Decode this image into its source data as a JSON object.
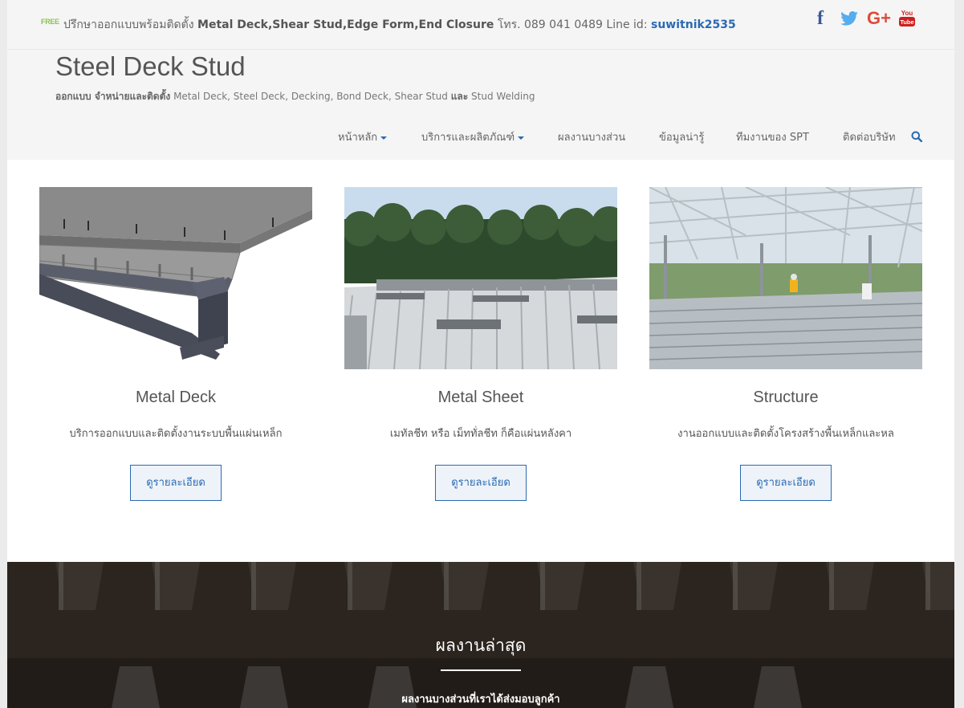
{
  "topbar": {
    "free_badge": "FREE",
    "text_prefix": "ปรึกษาออกแบบพร้อมติดตั้ง ",
    "text_products": "Metal Deck,Shear Stud,Edge Form,End Closure",
    "text_phone": " โทร. 089 041 0489 Line id: ",
    "line_id": "suwitnik2535",
    "social": {
      "facebook": "f",
      "google_plus": "G+",
      "youtube_top": "You",
      "youtube_bottom": "Tube"
    }
  },
  "header": {
    "site_title": "Steel Deck Stud",
    "tagline_lead": "ออกแบบ จำหน่ายและติดตั้ง",
    "tagline_items": " Metal Deck, Steel Deck, Decking, Bond Deck, Shear Stud ",
    "tagline_and": "และ",
    "tagline_tail": " Stud Welding"
  },
  "nav": {
    "home": "หน้าหลัก",
    "services": "บริการและผลิตภัณฑ์",
    "portfolio": "ผลงานบางส่วน",
    "info": "ข้อมูลน่ารู้",
    "team": "ทีมงานของ SPT",
    "contact": "ติดต่อบริษัท"
  },
  "services": [
    {
      "title": "Metal Deck",
      "desc": "บริการออกแบบและติดตั้งงานระบบพื้นแผ่นเหล็ก",
      "button": "ดูรายละเอียด"
    },
    {
      "title": "Metal Sheet",
      "desc": "เมทัลชีท หรือ เม็ททั่ลชีท ก็คือแผ่นหลังคา",
      "button": "ดูรายละเอียด"
    },
    {
      "title": "Structure",
      "desc": "งานออกแบบและติดตั้งโครงสร้างพื้นเหล็กและหล",
      "button": "ดูรายละเอียด"
    }
  ],
  "latest": {
    "title": "ผลงานล่าสุด",
    "subtitle": "ผลงานบางส่วนที่เราได้ส่งมอบลูกค้า"
  },
  "colors": {
    "accent": "#2a6ab2",
    "facebook": "#3b5998",
    "twitter": "#55acee",
    "google_plus": "#dd4b39",
    "youtube": "#cd201f"
  }
}
